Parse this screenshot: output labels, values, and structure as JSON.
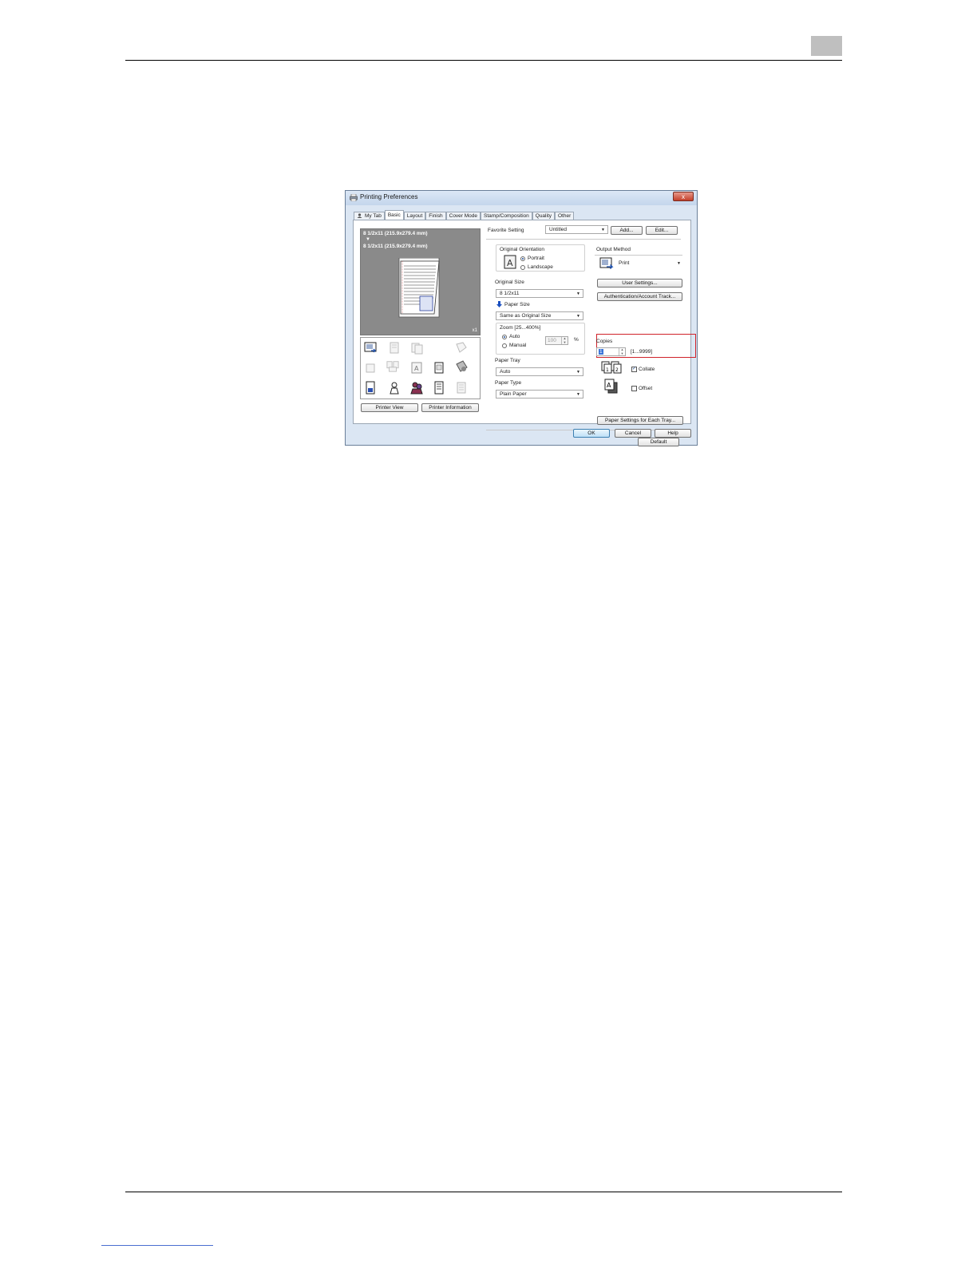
{
  "dialog": {
    "title": "Printing Preferences",
    "close_label": "x",
    "tabs": [
      {
        "label": "My Tab"
      },
      {
        "label": "Basic"
      },
      {
        "label": "Layout"
      },
      {
        "label": "Finish"
      },
      {
        "label": "Cover Mode"
      },
      {
        "label": "Stamp/Composition"
      },
      {
        "label": "Quality"
      },
      {
        "label": "Other"
      }
    ]
  },
  "preview": {
    "original_size_line": "8 1/2x11 (215.9x279.4 mm)",
    "paper_size_line": "8 1/2x11 (215.9x279.4 mm)",
    "arrow": "▼",
    "copy_count": "x1",
    "printer_view_label": "Printer View",
    "printer_information_label": "Printer Information"
  },
  "favorite": {
    "label": "Favorite Setting",
    "value": "Untitled",
    "add_label": "Add...",
    "edit_label": "Edit..."
  },
  "orientation": {
    "label": "Original Orientation",
    "portrait_label": "Portrait",
    "landscape_label": "Landscape",
    "selected": "Portrait"
  },
  "original_size": {
    "label": "Original Size",
    "value": "8 1/2x11"
  },
  "paper_size": {
    "label": "Paper Size",
    "value": "Same as Original Size"
  },
  "zoom": {
    "label": "Zoom [25...400%]",
    "auto_label": "Auto",
    "manual_label": "Manual",
    "value": "100",
    "unit": "%",
    "selected": "Auto"
  },
  "paper_tray": {
    "label": "Paper Tray",
    "value": "Auto"
  },
  "paper_type": {
    "label": "Paper Type",
    "value": "Plain Paper"
  },
  "output_method": {
    "label": "Output Method",
    "value": "Print",
    "user_settings_label": "User Settings...",
    "authentication_label": "Authentication/Account Track..."
  },
  "copies": {
    "label": "Copies",
    "value": "1",
    "range": "[1...9999]",
    "collate_label": "Collate",
    "collate_checked": true,
    "offset_label": "Offset",
    "offset_checked": false,
    "highlight_color": "#d0232a"
  },
  "paper_settings_each_tray_label": "Paper Settings for Each Tray...",
  "default_label": "Default",
  "footer_buttons": {
    "ok": "OK",
    "cancel": "Cancel",
    "help": "Help"
  }
}
